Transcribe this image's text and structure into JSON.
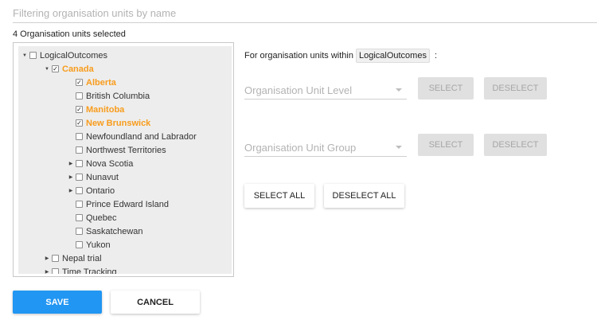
{
  "filter": {
    "placeholder": "Filtering organisation units by name",
    "value": ""
  },
  "selected_count_text": "4 Organisation units selected",
  "tree": {
    "root": {
      "label": "LogicalOutcomes",
      "checked": false,
      "expanded": true
    },
    "canada": {
      "label": "Canada",
      "checked": true,
      "expanded": true
    },
    "provinces": [
      {
        "label": "Alberta",
        "checked": true,
        "has_children": false
      },
      {
        "label": "British Columbia",
        "checked": false,
        "has_children": false
      },
      {
        "label": "Manitoba",
        "checked": true,
        "has_children": false
      },
      {
        "label": "New Brunswick",
        "checked": true,
        "has_children": false
      },
      {
        "label": "Newfoundland and Labrador",
        "checked": false,
        "has_children": false
      },
      {
        "label": "Northwest Territories",
        "checked": false,
        "has_children": false
      },
      {
        "label": "Nova Scotia",
        "checked": false,
        "has_children": true
      },
      {
        "label": "Nunavut",
        "checked": false,
        "has_children": true
      },
      {
        "label": "Ontario",
        "checked": false,
        "has_children": true
      },
      {
        "label": "Prince Edward Island",
        "checked": false,
        "has_children": false
      },
      {
        "label": "Quebec",
        "checked": false,
        "has_children": false
      },
      {
        "label": "Saskatchewan",
        "checked": false,
        "has_children": false
      },
      {
        "label": "Yukon",
        "checked": false,
        "has_children": false
      }
    ],
    "siblings": [
      {
        "label": "Nepal trial",
        "checked": false,
        "has_children": true
      },
      {
        "label": "Time Tracking",
        "checked": false,
        "has_children": true
      }
    ]
  },
  "within": {
    "prefix": "For organisation units within",
    "unit": "LogicalOutcomes",
    "suffix": ":"
  },
  "level": {
    "placeholder": "Organisation Unit Level",
    "select_label": "SELECT",
    "deselect_label": "DESELECT"
  },
  "group": {
    "placeholder": "Organisation Unit Group",
    "select_label": "SELECT",
    "deselect_label": "DESELECT"
  },
  "select_all_label": "SELECT ALL",
  "deselect_all_label": "DESELECT ALL",
  "save_label": "SAVE",
  "cancel_label": "CANCEL",
  "colors": {
    "selected_text": "#f89c1c",
    "primary": "#2196f3",
    "disabled_bg": "#e0e0e0"
  }
}
